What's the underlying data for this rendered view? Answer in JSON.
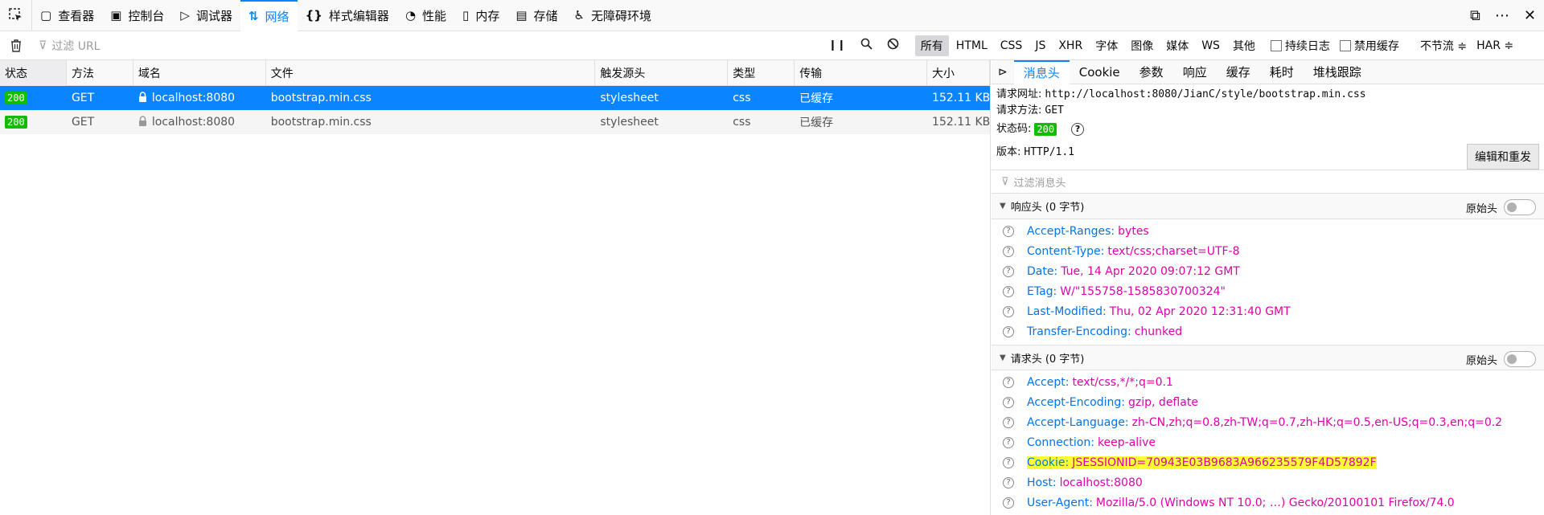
{
  "toolbar": {
    "tabs": [
      {
        "label": "查看器",
        "icon": "inspector-icon"
      },
      {
        "label": "控制台",
        "icon": "console-icon"
      },
      {
        "label": "调试器",
        "icon": "debugger-icon"
      },
      {
        "label": "网络",
        "icon": "network-icon"
      },
      {
        "label": "样式编辑器",
        "icon": "style-editor-icon"
      },
      {
        "label": "性能",
        "icon": "performance-icon"
      },
      {
        "label": "内存",
        "icon": "memory-icon"
      },
      {
        "label": "存储",
        "icon": "storage-icon"
      },
      {
        "label": "无障碍环境",
        "icon": "accessibility-icon"
      }
    ],
    "active_tab": "网络"
  },
  "filterbar": {
    "url_placeholder": "过滤 URL",
    "types": [
      "所有",
      "HTML",
      "CSS",
      "JS",
      "XHR",
      "字体",
      "图像",
      "媒体",
      "WS",
      "其他"
    ],
    "active_type": "所有",
    "persist_log": "持续日志",
    "disable_cache": "禁用缓存",
    "throttle": "不节流 ≑",
    "har": "HAR ≑"
  },
  "table": {
    "columns": [
      "状态",
      "方法",
      "域名",
      "文件",
      "触发源头",
      "类型",
      "传输",
      "大小"
    ],
    "rows": [
      {
        "status": "200",
        "method": "GET",
        "domain": "localhost:8080",
        "file": "bootstrap.min.css",
        "cause": "stylesheet",
        "type": "css",
        "transferred": "已缓存",
        "size": "152.11 KB",
        "selected": true
      },
      {
        "status": "200",
        "method": "GET",
        "domain": "localhost:8080",
        "file": "bootstrap.min.css",
        "cause": "stylesheet",
        "type": "css",
        "transferred": "已缓存",
        "size": "152.11 KB",
        "selected": false
      }
    ]
  },
  "details": {
    "tabs": [
      "消息头",
      "Cookie",
      "参数",
      "响应",
      "缓存",
      "耗时",
      "堆栈跟踪"
    ],
    "active_tab": "消息头",
    "request_url_label": "请求网址:",
    "request_url": "http://localhost:8080/JianC/style/bootstrap.min.css",
    "request_method_label": "请求方法:",
    "request_method": "GET",
    "status_label": "状态码:",
    "status_code": "200",
    "version_label": "版本:",
    "version": "HTTP/1.1",
    "resend_button": "编辑和重发",
    "filter_placeholder": "过滤消息头",
    "response_headers_title": "响应头 (0 字节)",
    "raw_headers_label": "原始头",
    "response_headers": [
      {
        "name": "Accept-Ranges:",
        "value": "bytes"
      },
      {
        "name": "Content-Type:",
        "value": "text/css;charset=UTF-8"
      },
      {
        "name": "Date:",
        "value": "Tue, 14 Apr 2020 09:07:12 GMT"
      },
      {
        "name": "ETag:",
        "value": "W/\"155758-1585830700324\""
      },
      {
        "name": "Last-Modified:",
        "value": "Thu, 02 Apr 2020 12:31:40 GMT"
      },
      {
        "name": "Transfer-Encoding:",
        "value": "chunked"
      }
    ],
    "request_headers_title": "请求头 (0 字节)",
    "request_headers": [
      {
        "name": "Accept:",
        "value": "text/css,*/*;q=0.1"
      },
      {
        "name": "Accept-Encoding:",
        "value": "gzip, deflate"
      },
      {
        "name": "Accept-Language:",
        "value": "zh-CN,zh;q=0.8,zh-TW;q=0.7,zh-HK;q=0.5,en-US;q=0.3,en;q=0.2"
      },
      {
        "name": "Connection:",
        "value": "keep-alive"
      },
      {
        "name": "Cookie:",
        "value": "JSESSIONID=70943E03B9683A966235579F4D57892F",
        "highlight": true
      },
      {
        "name": "Host:",
        "value": "localhost:8080"
      },
      {
        "name": "User-Agent:",
        "value": "Mozilla/5.0 (Windows NT 10.0; …) Gecko/20100101 Firefox/74.0"
      }
    ]
  }
}
